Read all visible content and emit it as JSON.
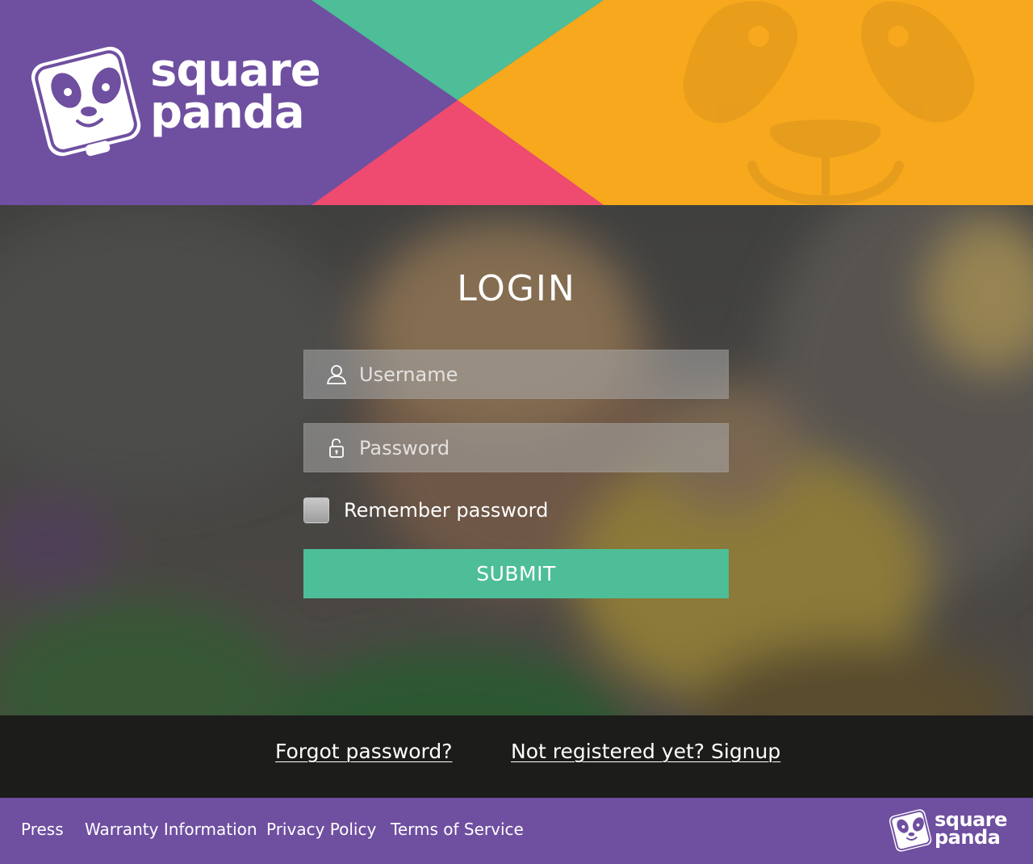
{
  "brand": {
    "line1": "square",
    "line2": "panda",
    "colors": {
      "purple": "#6f4fa0",
      "green": "#4dbe98",
      "pink": "#ef4a6f",
      "orange": "#f7a81c"
    }
  },
  "login": {
    "title": "LOGIN",
    "username": {
      "placeholder": "Username",
      "value": "",
      "icon": "user-icon"
    },
    "password": {
      "placeholder": "Password",
      "value": "",
      "icon": "unlock-icon"
    },
    "remember_label": "Remember password",
    "remember_checked": false,
    "submit_label": "SUBMIT"
  },
  "links": {
    "forgot": "Forgot password?",
    "signup": "Not registered yet? Signup"
  },
  "footer": {
    "items": [
      "Press",
      "Warranty Information",
      "Privacy Policy",
      "Terms of Service"
    ]
  }
}
